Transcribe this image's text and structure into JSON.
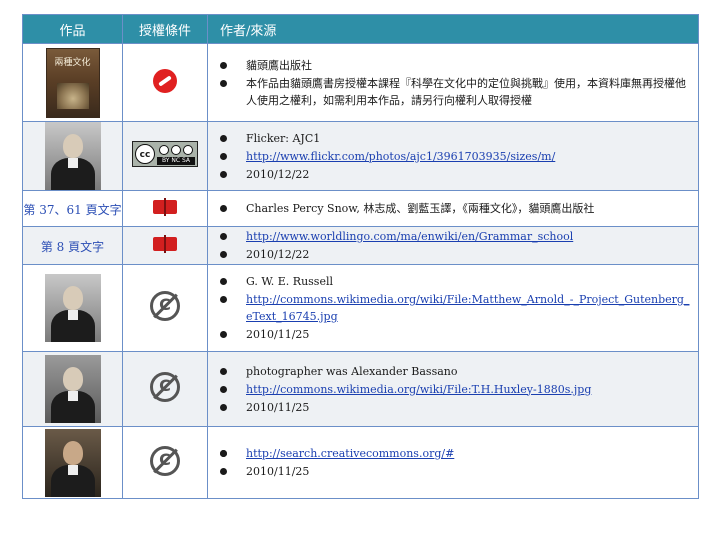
{
  "header": {
    "col_work": "作品",
    "col_license": "授權條件",
    "col_source": "作者/來源"
  },
  "rows": [
    {
      "work": {
        "type": "image",
        "image": "book-cover",
        "book_title": "兩種文化"
      },
      "license_icon": "copyright-restricted-icon",
      "items": [
        "貓頭鷹出版社",
        "本作品由貓頭鷹書房授權本課程『科學在文化中的定位與挑戰』使用，本資料庫無再授權他人使用之權利，如需利用本作品，請另行向權利人取得授權"
      ]
    },
    {
      "work": {
        "type": "image",
        "image": "portrait-man-with-hand"
      },
      "license_icon": "cc-by-nc-sa-icon",
      "license_strip": "BY   NC   SA",
      "items": [
        "Flicker: AJC1",
        {
          "link": "http://www.flickr.com/photos/ajc1/3961703935/sizes/m/"
        },
        "2010/12/22"
      ]
    },
    {
      "work": {
        "type": "text",
        "label": "第 37、61 頁文字"
      },
      "license_icon": "book-icon",
      "items": [
        "Charles Percy Snow, 林志成、劉藍玉譯，《兩種文化》，貓頭鷹出版社"
      ]
    },
    {
      "work": {
        "type": "text",
        "label": "第 8 頁文字"
      },
      "license_icon": "book-icon",
      "items": [
        {
          "link": "http://www.worldlingo.com/ma/enwiki/en/Grammar_school"
        },
        "2010/12/22"
      ]
    },
    {
      "work": {
        "type": "image",
        "image": "portrait-matthew-arnold"
      },
      "license_icon": "public-domain-icon",
      "items": [
        "G. W. E. Russell",
        {
          "link": "http://commons.wikimedia.org/wiki/File:Matthew_Arnold_-_Project_Gutenberg_eText_16745.jpg"
        },
        "2010/11/25"
      ]
    },
    {
      "work": {
        "type": "image",
        "image": "portrait-th-huxley"
      },
      "license_icon": "public-domain-icon",
      "items": [
        "photographer was Alexander Bassano",
        {
          "link": "http://commons.wikimedia.org/wiki/File:T.H.Huxley-1880s.jpg"
        },
        "2010/11/25"
      ]
    },
    {
      "work": {
        "type": "image",
        "image": "portrait-standing-man"
      },
      "license_icon": "public-domain-icon",
      "items": [
        "",
        {
          "link": "http://search.creativecommons.org/#"
        },
        "2010/11/25"
      ]
    }
  ]
}
